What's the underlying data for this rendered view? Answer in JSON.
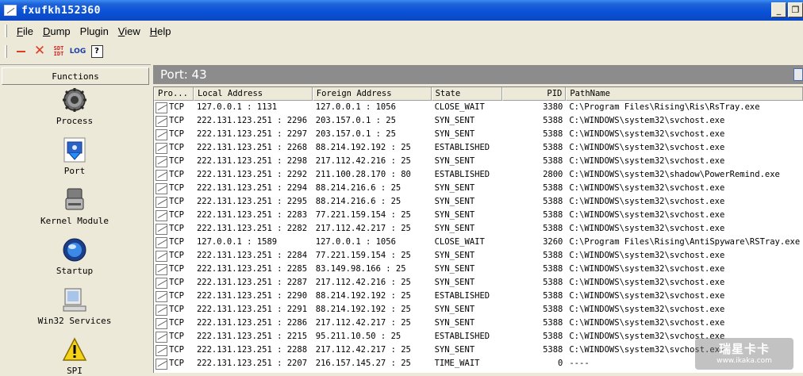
{
  "window": {
    "title": "fxufkh152360",
    "controls": [
      "_",
      "❐",
      "✕"
    ]
  },
  "menu": [
    {
      "letter": "F",
      "rest": "ile"
    },
    {
      "letter": "D",
      "rest": "ump"
    },
    {
      "letter": "",
      "rest": "Plugin"
    },
    {
      "letter": "V",
      "rest": "iew"
    },
    {
      "letter": "H",
      "rest": "elp"
    }
  ],
  "toolbar": {
    "sdt_top": "SDT",
    "sdt_bottom": "IDT",
    "log": "LOG",
    "help": "?"
  },
  "sidebar": {
    "header": "Functions",
    "items": [
      {
        "label": "Process",
        "icon": "gear-icon"
      },
      {
        "label": "Port",
        "icon": "port-icon"
      },
      {
        "label": "Kernel Module",
        "icon": "disk-icon"
      },
      {
        "label": "Startup",
        "icon": "startup-icon"
      },
      {
        "label": "Win32 Services",
        "icon": "computer-icon"
      },
      {
        "label": "SPI",
        "icon": "warning-icon"
      }
    ]
  },
  "port_bar": {
    "title": "Port: 43"
  },
  "columns": [
    "Pro...",
    "Local Address",
    "Foreign Address",
    "State",
    "PID",
    "PathName"
  ],
  "rows": [
    {
      "proto": "TCP",
      "local": "127.0.0.1 : 1131",
      "foreign": "127.0.0.1 : 1056",
      "state": "CLOSE_WAIT",
      "pid": "3380",
      "path": "C:\\Program Files\\Rising\\Ris\\RsTray.exe"
    },
    {
      "proto": "TCP",
      "local": "222.131.123.251 : 2296",
      "foreign": "203.157.0.1 : 25",
      "state": "SYN_SENT",
      "pid": "5388",
      "path": "C:\\WINDOWS\\system32\\svchost.exe"
    },
    {
      "proto": "TCP",
      "local": "222.131.123.251 : 2297",
      "foreign": "203.157.0.1 : 25",
      "state": "SYN_SENT",
      "pid": "5388",
      "path": "C:\\WINDOWS\\system32\\svchost.exe"
    },
    {
      "proto": "TCP",
      "local": "222.131.123.251 : 2268",
      "foreign": "88.214.192.192 : 25",
      "state": "ESTABLISHED",
      "pid": "5388",
      "path": "C:\\WINDOWS\\system32\\svchost.exe"
    },
    {
      "proto": "TCP",
      "local": "222.131.123.251 : 2298",
      "foreign": "217.112.42.216 : 25",
      "state": "SYN_SENT",
      "pid": "5388",
      "path": "C:\\WINDOWS\\system32\\svchost.exe"
    },
    {
      "proto": "TCP",
      "local": "222.131.123.251 : 2292",
      "foreign": "211.100.28.170 : 80",
      "state": "ESTABLISHED",
      "pid": "2800",
      "path": "C:\\WINDOWS\\system32\\shadow\\PowerRemind.exe"
    },
    {
      "proto": "TCP",
      "local": "222.131.123.251 : 2294",
      "foreign": "88.214.216.6 : 25",
      "state": "SYN_SENT",
      "pid": "5388",
      "path": "C:\\WINDOWS\\system32\\svchost.exe"
    },
    {
      "proto": "TCP",
      "local": "222.131.123.251 : 2295",
      "foreign": "88.214.216.6 : 25",
      "state": "SYN_SENT",
      "pid": "5388",
      "path": "C:\\WINDOWS\\system32\\svchost.exe"
    },
    {
      "proto": "TCP",
      "local": "222.131.123.251 : 2283",
      "foreign": "77.221.159.154 : 25",
      "state": "SYN_SENT",
      "pid": "5388",
      "path": "C:\\WINDOWS\\system32\\svchost.exe"
    },
    {
      "proto": "TCP",
      "local": "222.131.123.251 : 2282",
      "foreign": "217.112.42.217 : 25",
      "state": "SYN_SENT",
      "pid": "5388",
      "path": "C:\\WINDOWS\\system32\\svchost.exe"
    },
    {
      "proto": "TCP",
      "local": "127.0.0.1 : 1589",
      "foreign": "127.0.0.1 : 1056",
      "state": "CLOSE_WAIT",
      "pid": "3260",
      "path": "C:\\Program Files\\Rising\\AntiSpyware\\RSTray.exe"
    },
    {
      "proto": "TCP",
      "local": "222.131.123.251 : 2284",
      "foreign": "77.221.159.154 : 25",
      "state": "SYN_SENT",
      "pid": "5388",
      "path": "C:\\WINDOWS\\system32\\svchost.exe"
    },
    {
      "proto": "TCP",
      "local": "222.131.123.251 : 2285",
      "foreign": "83.149.98.166 : 25",
      "state": "SYN_SENT",
      "pid": "5388",
      "path": "C:\\WINDOWS\\system32\\svchost.exe"
    },
    {
      "proto": "TCP",
      "local": "222.131.123.251 : 2287",
      "foreign": "217.112.42.216 : 25",
      "state": "SYN_SENT",
      "pid": "5388",
      "path": "C:\\WINDOWS\\system32\\svchost.exe"
    },
    {
      "proto": "TCP",
      "local": "222.131.123.251 : 2290",
      "foreign": "88.214.192.192 : 25",
      "state": "ESTABLISHED",
      "pid": "5388",
      "path": "C:\\WINDOWS\\system32\\svchost.exe"
    },
    {
      "proto": "TCP",
      "local": "222.131.123.251 : 2291",
      "foreign": "88.214.192.192 : 25",
      "state": "SYN_SENT",
      "pid": "5388",
      "path": "C:\\WINDOWS\\system32\\svchost.exe"
    },
    {
      "proto": "TCP",
      "local": "222.131.123.251 : 2286",
      "foreign": "217.112.42.217 : 25",
      "state": "SYN_SENT",
      "pid": "5388",
      "path": "C:\\WINDOWS\\system32\\svchost.exe"
    },
    {
      "proto": "TCP",
      "local": "222.131.123.251 : 2215",
      "foreign": "95.211.10.50 : 25",
      "state": "ESTABLISHED",
      "pid": "5388",
      "path": "C:\\WINDOWS\\system32\\svchost.exe"
    },
    {
      "proto": "TCP",
      "local": "222.131.123.251 : 2288",
      "foreign": "217.112.42.217 : 25",
      "state": "SYN_SENT",
      "pid": "5388",
      "path": "C:\\WINDOWS\\system32\\svchost.exe"
    },
    {
      "proto": "TCP",
      "local": "222.131.123.251 : 2207",
      "foreign": "216.157.145.27 : 25",
      "state": "TIME_WAIT",
      "pid": "0",
      "path": "----"
    }
  ],
  "watermark": {
    "line1": "瑞星卡卡",
    "line2": "www.ikaka.com"
  },
  "colors": {
    "titlebar": "#0a52d8",
    "port_bar": "#8c8c8c",
    "toolbar_red": "#e03b24"
  }
}
